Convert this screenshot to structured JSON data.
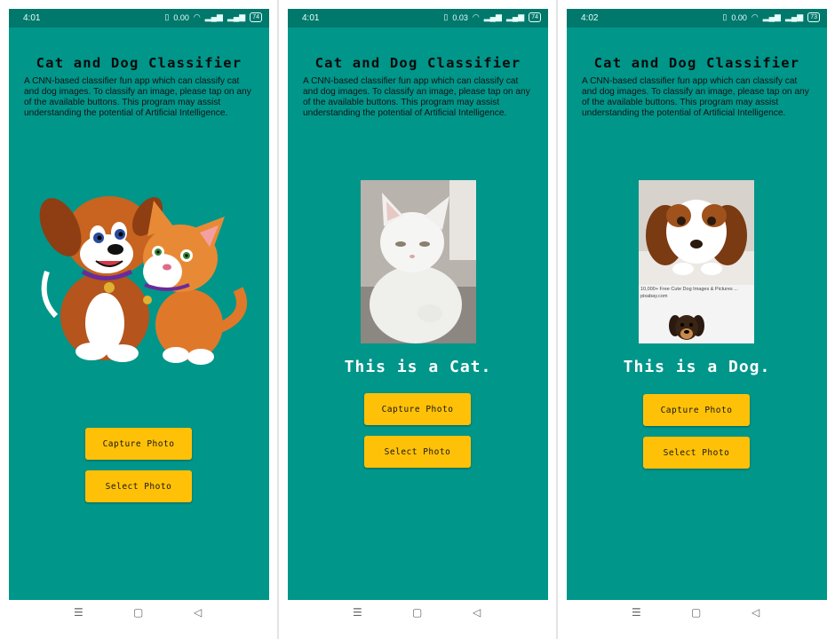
{
  "app": {
    "title": "Cat and Dog Classifier",
    "description": "A CNN-based classifier fun app which can classify cat and dog images. To classify an image, please tap on any of the available buttons. This program may assist understanding the potential of Artificial Intelligence.",
    "capture_label": "Capture Photo",
    "select_label": "Select Photo"
  },
  "screens": [
    {
      "time": "4:01",
      "net_speed": "0.00",
      "battery": "74",
      "result": ""
    },
    {
      "time": "4:01",
      "net_speed": "0.03",
      "battery": "74",
      "result": "This is a Cat."
    },
    {
      "time": "4:02",
      "net_speed": "0.00",
      "battery": "73",
      "result": "This is a Dog.",
      "photo_caption": "10,000+ Free Cute Dog Images & Pictures ...",
      "photo_source": "pixabay.com"
    }
  ],
  "status_icons": [
    "vibrate-icon",
    "wifi-icon",
    "signal-icon",
    "signal-icon",
    "battery-icon"
  ],
  "nav_icons": [
    "menu-icon",
    "home-icon",
    "back-icon"
  ],
  "nav_glyphs": {
    "menu": "☰",
    "home": "▢",
    "back": "◁"
  },
  "colors": {
    "background": "#00968A",
    "status_bar": "#00786C",
    "button": "#FFC107",
    "result_text": "#FFFFFF"
  }
}
